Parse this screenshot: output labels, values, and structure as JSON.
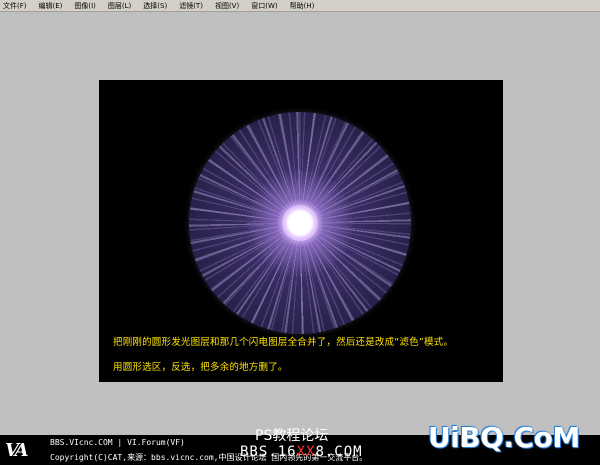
{
  "menu": {
    "items": [
      "文件(F)",
      "编辑(E)",
      "图像(I)",
      "图层(L)",
      "选择(S)",
      "滤镜(T)",
      "视图(V)",
      "窗口(W)",
      "帮助(H)"
    ]
  },
  "canvas": {
    "caption1": "把刚刚的圆形发光图层和那几个闪电图层全合并了，然后还是改成“滤色”模式。",
    "caption2": "用圆形选区，反选，把多余的地方删了。"
  },
  "footer": {
    "logo": "VA",
    "line1": "BBS.VIcnc.COM | VI.Forum(VF)",
    "line2": "Copyright(C)CAT,来源：bbs.vicnc.com,中国设计论坛 国内领先的第一交流平台。"
  },
  "watermark": {
    "ps": "PS教程论坛",
    "bbs_prefix": "BBS.16",
    "bbs_red": "XX",
    "bbs_suffix": "8.COM",
    "uibq": "UiBQ.CoM"
  },
  "colors": {
    "caption": "#ffe400",
    "background": "#c0c0c0",
    "canvas": "#000000",
    "uibq_outline": "#2a7fd4"
  }
}
